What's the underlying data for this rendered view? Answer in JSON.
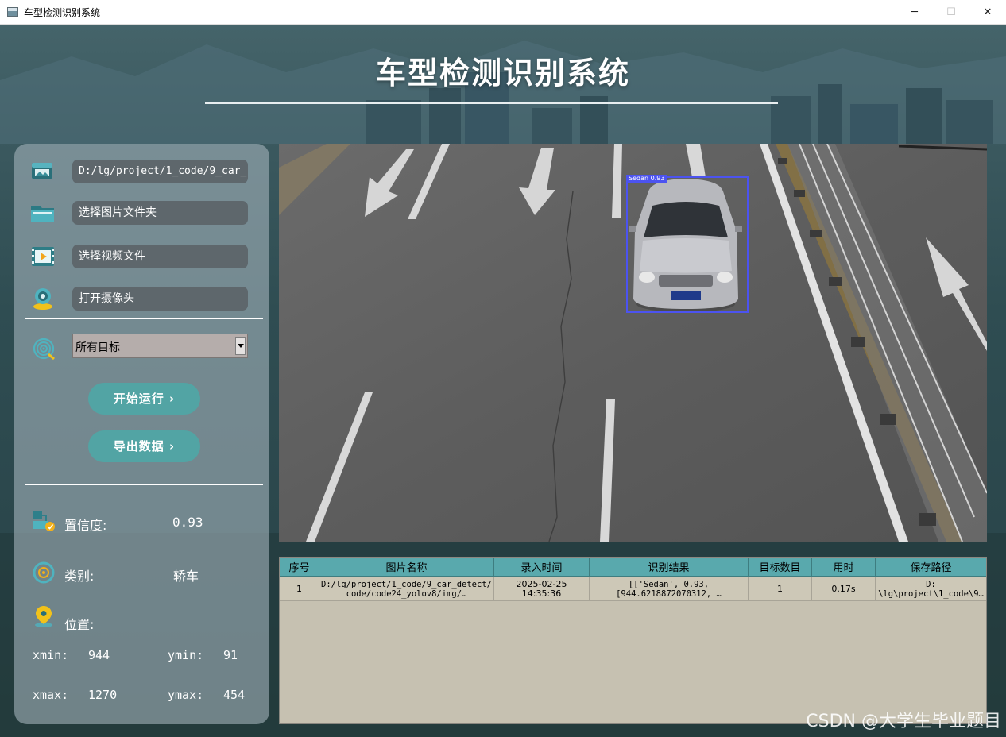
{
  "window": {
    "title": "车型检测识别系统",
    "minimize_glyph": "─",
    "maximize_glyph": "☐",
    "close_glyph": "✕"
  },
  "header": {
    "title": "车型检测识别系统"
  },
  "sidebar": {
    "file_path": "D:/lg/project/1_code/9_car_",
    "select_folder": "选择图片文件夹",
    "select_video": "选择视频文件",
    "open_camera": "打开摄像头",
    "target_select": {
      "selected": "所有目标"
    },
    "start_button": "开始运行 ›",
    "export_button": "导出数据 ›",
    "confidence_label": "置信度:",
    "confidence_value": "0.93",
    "class_label": "类别:",
    "class_value": "轿车",
    "position_label": "位置:",
    "xmin_label": "xmin:",
    "xmin_value": "944",
    "ymin_label": "ymin:",
    "ymin_value": "91",
    "xmax_label": "xmax:",
    "xmax_value": "1270",
    "ymax_label": "ymax:",
    "ymax_value": "454"
  },
  "detection": {
    "label": "Sedan  0.93",
    "box_color": "#4c53f0"
  },
  "results_table": {
    "columns": [
      "序号",
      "图片名称",
      "录入时间",
      "识别结果",
      "目标数目",
      "用时",
      "保存路径"
    ],
    "rows": [
      {
        "index": "1",
        "image_line1": "D:/lg/project/1_code/9_car_detect/",
        "image_line2": "code/code24_yolov8/img/…",
        "time_line1": "2025-02-25",
        "time_line2": "14:35:36",
        "result_line1": "[['Sedan', 0.93,",
        "result_line2": "[944.6218872070312, …",
        "count": "1",
        "duration": "0.17s",
        "save_line1": "D:",
        "save_line2": "\\lg\\project\\1_code\\9…"
      }
    ]
  },
  "icons": {
    "file": "image-file-icon",
    "folder": "folder-icon",
    "video": "video-icon",
    "camera": "webcam-icon",
    "target": "target-icon",
    "confidence": "confidence-icon",
    "class": "class-icon",
    "position": "location-pin-icon"
  },
  "colors": {
    "accent": "#52a4a4",
    "table_header": "#59a9ad",
    "table_body": "#c6c1b1"
  },
  "watermark": "CSDN @大学生毕业题目"
}
